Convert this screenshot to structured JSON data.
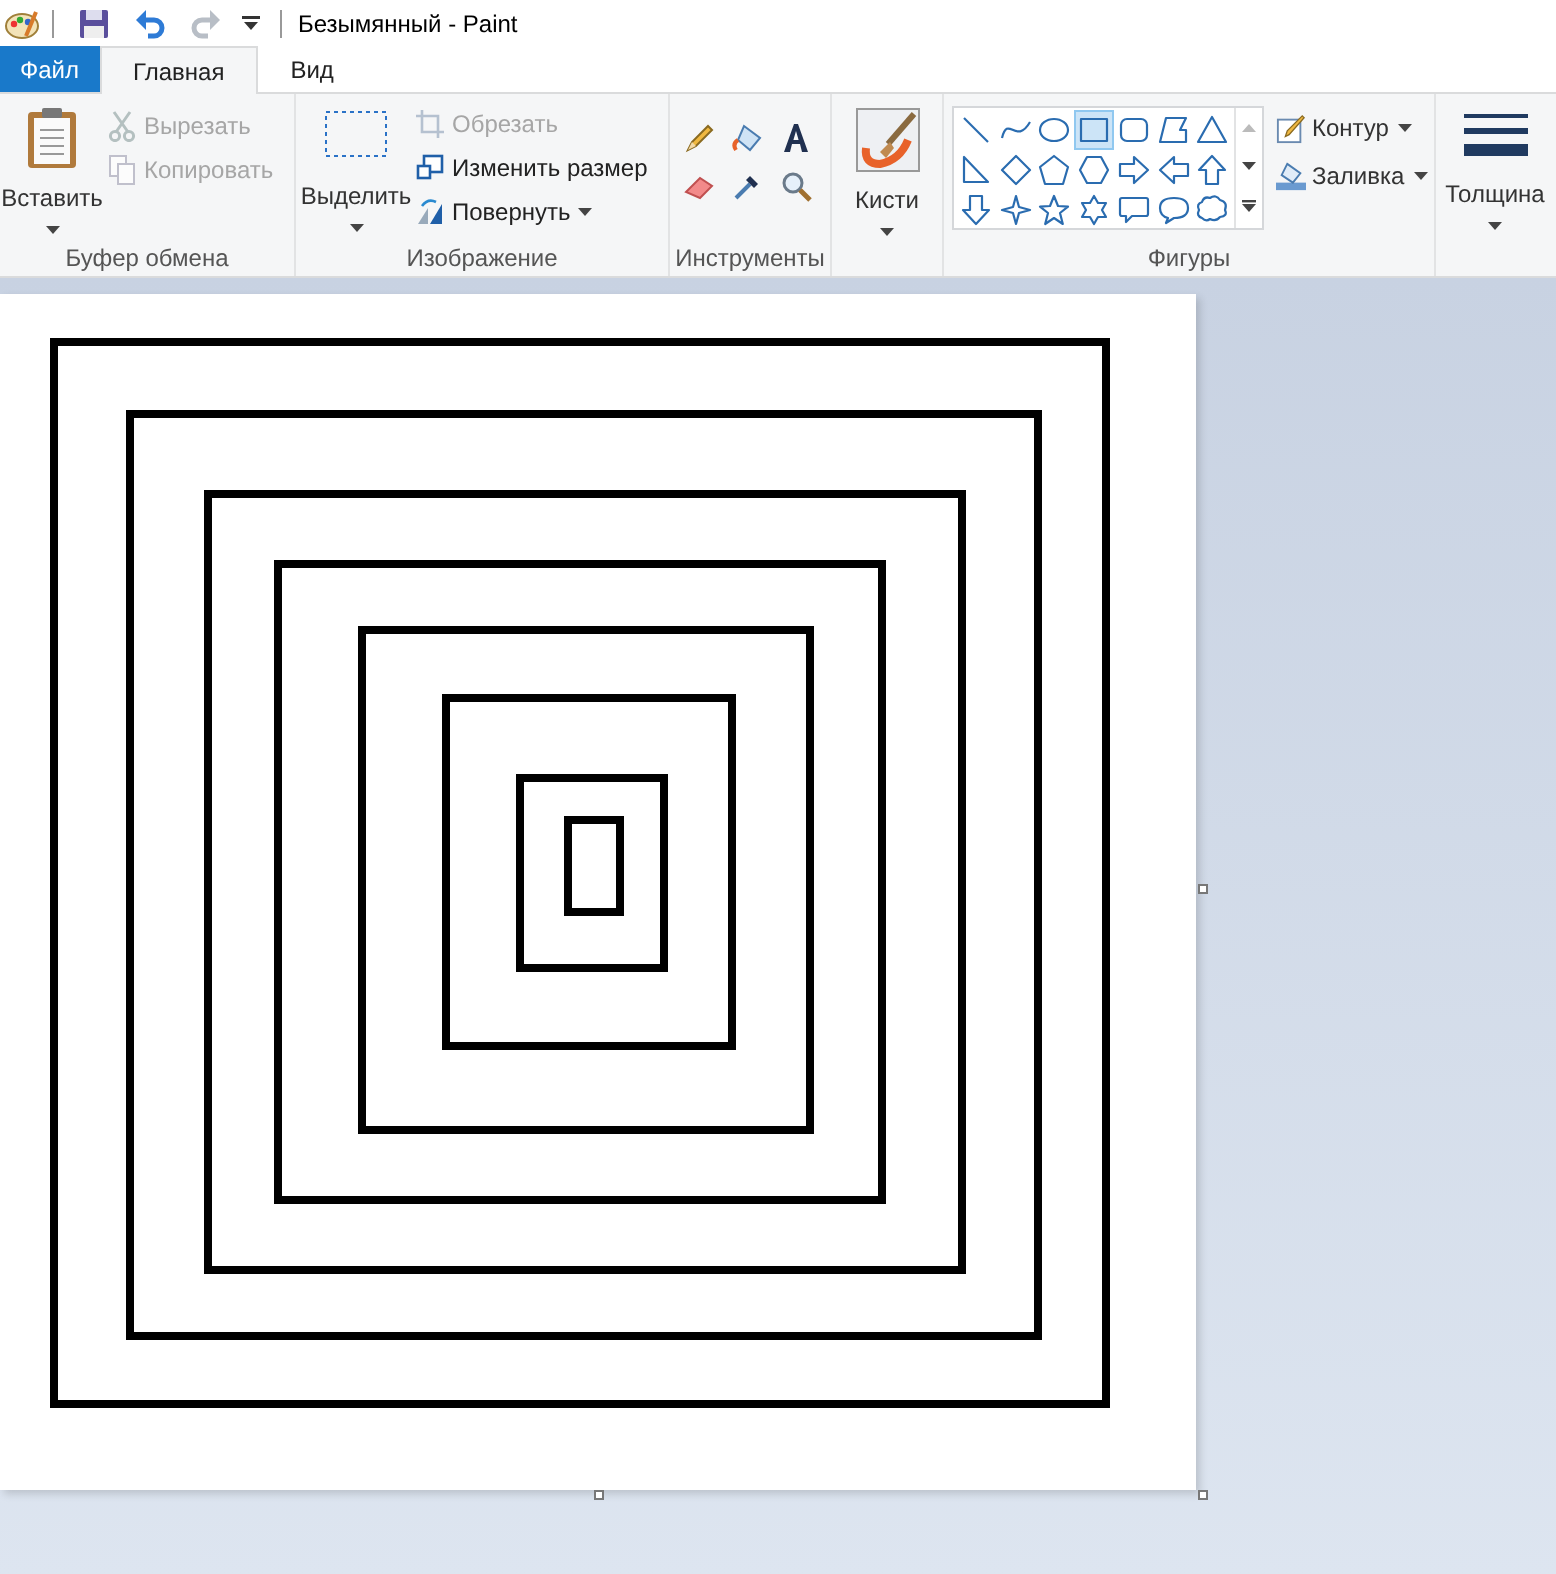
{
  "title_bar": {
    "title": "Безымянный - Paint"
  },
  "tabs": [
    {
      "label": "Файл",
      "kind": "file",
      "selected": false
    },
    {
      "label": "Главная",
      "kind": "tab",
      "selected": true
    },
    {
      "label": "Вид",
      "kind": "tab",
      "selected": false
    }
  ],
  "clipboard": {
    "label": "Буфер обмена",
    "paste": "Вставить",
    "cut": {
      "label": "Вырезать",
      "disabled": true
    },
    "copy": {
      "label": "Копировать",
      "disabled": true
    }
  },
  "image": {
    "label": "Изображение",
    "select": "Выделить",
    "crop": {
      "label": "Обрезать",
      "disabled": true
    },
    "resize": {
      "label": "Изменить размер",
      "disabled": false
    },
    "rotate": {
      "label": "Повернуть",
      "disabled": false
    }
  },
  "tools": {
    "label": "Инструменты"
  },
  "brushes": {
    "label": "Кисти"
  },
  "shapes": {
    "label": "Фигуры",
    "outline": "Контур",
    "fill": "Заливка",
    "items": [
      {
        "kind": "line",
        "selected": false
      },
      {
        "kind": "curve",
        "selected": false
      },
      {
        "kind": "oval",
        "selected": false
      },
      {
        "kind": "rectangle",
        "selected": true
      },
      {
        "kind": "rounded",
        "selected": false
      },
      {
        "kind": "polygon",
        "selected": false
      },
      {
        "kind": "triangle",
        "selected": false
      },
      {
        "kind": "right-triangle",
        "selected": false
      },
      {
        "kind": "diamond",
        "selected": false
      },
      {
        "kind": "pentagon",
        "selected": false
      },
      {
        "kind": "hexagon",
        "selected": false
      },
      {
        "kind": "arrow-right",
        "selected": false
      },
      {
        "kind": "arrow-left",
        "selected": false
      },
      {
        "kind": "arrow-up",
        "selected": false
      },
      {
        "kind": "arrow-down",
        "selected": false
      },
      {
        "kind": "star4",
        "selected": false
      },
      {
        "kind": "star5",
        "selected": false
      },
      {
        "kind": "star6",
        "selected": false
      },
      {
        "kind": "callout-rect",
        "selected": false
      },
      {
        "kind": "callout-oval",
        "selected": false
      },
      {
        "kind": "callout-cloud",
        "selected": false
      }
    ]
  },
  "size": {
    "label": "Толщина"
  }
}
